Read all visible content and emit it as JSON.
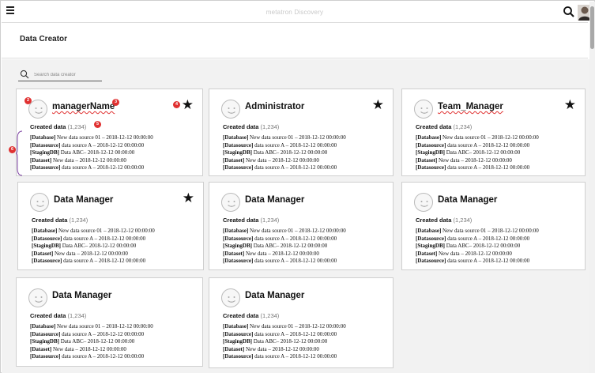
{
  "app": {
    "title": "metatron Discovery"
  },
  "page": {
    "title": "Data Creator"
  },
  "search": {
    "placeholder": "Search data creator"
  },
  "cards": [
    {
      "name": "managerName",
      "starred": true,
      "squiggle": true,
      "created_label": "Created data",
      "created_count": "(1,234)",
      "entries": [
        {
          "type": "[Database]",
          "text": " New data source 01 – 2018-12-12 00:00:00"
        },
        {
          "type": "[Datasource]",
          "text": " data source A – 2018-12-12 00:00:00"
        },
        {
          "type": "[StagingDB]",
          "text": " Data ABC– 2018-12-12 00:00:00"
        },
        {
          "type": "[Dataset]",
          "text": " New data – 2018-12-12 00:00:00"
        },
        {
          "type": "[Datasource]",
          "text": " data source A – 2018-12-12 00:00:00"
        }
      ],
      "markers": [
        "2",
        "3",
        "4",
        "5",
        "6"
      ]
    },
    {
      "name": "Administrator",
      "starred": true,
      "squiggle": false,
      "created_label": "Created data",
      "created_count": "(1,234)",
      "entries": [
        {
          "type": "[Database]",
          "text": " New data source 01 – 2018-12-12 00:00:00"
        },
        {
          "type": "[Datasource]",
          "text": " data source A – 2018-12-12 00:00:00"
        },
        {
          "type": "[StagingDB]",
          "text": " Data ABC– 2018-12-12 00:00:00"
        },
        {
          "type": "[Dataset]",
          "text": " New data – 2018-12-12 00:00:00"
        },
        {
          "type": "[Datasource]",
          "text": " data source A – 2018-12-12 00:00:00"
        }
      ]
    },
    {
      "name": "Team_Manager",
      "starred": true,
      "squiggle": true,
      "created_label": "Created data",
      "created_count": "(1,234)",
      "entries": [
        {
          "type": "[Database]",
          "text": " New data source 01 – 2018-12-12 00:00:00"
        },
        {
          "type": "[Datasource]",
          "text": " data source A – 2018-12-12 00:00:00"
        },
        {
          "type": "[StagingDB]",
          "text": " Data ABC– 2018-12-12 00:00:00"
        },
        {
          "type": "[Dataset]",
          "text": " New data – 2018-12-12 00:00:00"
        },
        {
          "type": "[Datasource]",
          "text": " data source A – 2018-12-12 00:00:00"
        }
      ]
    },
    {
      "name": "Data Manager",
      "starred": true,
      "squiggle": false,
      "created_label": "Created data",
      "created_count": "(1,234)",
      "entries": [
        {
          "type": "[Database]",
          "text": " New data source 01 – 2018-12-12 00:00:00"
        },
        {
          "type": "[Datasource]",
          "text": " data source A – 2018-12-12 00:00:00"
        },
        {
          "type": "[StagingDB]",
          "text": " Data ABC– 2018-12-12 00:00:00"
        },
        {
          "type": "[Dataset]",
          "text": " New data – 2018-12-12 00:00:00"
        },
        {
          "type": "[Datasource]",
          "text": " data source A – 2018-12-12 00:00:00"
        }
      ]
    },
    {
      "name": "Data Manager",
      "starred": false,
      "squiggle": false,
      "created_label": "Created data",
      "created_count": "(1,234)",
      "entries": [
        {
          "type": "[Database]",
          "text": " New data source 01 – 2018-12-12 00:00:00"
        },
        {
          "type": "[Datasource]",
          "text": " data source A – 2018-12-12 00:00:00"
        },
        {
          "type": "[StagingDB]",
          "text": " Data ABC– 2018-12-12 00:00:00"
        },
        {
          "type": "[Dataset]",
          "text": " New data – 2018-12-12 00:00:00"
        },
        {
          "type": "[Datasource]",
          "text": " data source A – 2018-12-12 00:00:00"
        }
      ]
    },
    {
      "name": "Data Manager",
      "starred": false,
      "squiggle": false,
      "created_label": "Created data",
      "created_count": "(1,234)",
      "entries": [
        {
          "type": "[Database]",
          "text": " New data source 01 – 2018-12-12 00:00:00"
        },
        {
          "type": "[Datasource]",
          "text": " data source A – 2018-12-12 00:00:00"
        },
        {
          "type": "[StagingDB]",
          "text": " Data ABC– 2018-12-12 00:00:00"
        },
        {
          "type": "[Dataset]",
          "text": " New data – 2018-12-12 00:00:00"
        },
        {
          "type": "[Datasource]",
          "text": " data source A – 2018-12-12 00:00:00"
        }
      ]
    },
    {
      "name": "Data Manager",
      "starred": false,
      "squiggle": false,
      "created_label": "Created data",
      "created_count": "(1,234)",
      "entries": [
        {
          "type": "[Database]",
          "text": " New data source 01 – 2018-12-12 00:00:00"
        },
        {
          "type": "[Datasource]",
          "text": " data source A – 2018-12-12 00:00:00"
        },
        {
          "type": "[StagingDB]",
          "text": " Data ABC– 2018-12-12 00:00:00"
        },
        {
          "type": "[Dataset]",
          "text": " New data – 2018-12-12 00:00:00"
        },
        {
          "type": "[Datasource]",
          "text": " data source A – 2018-12-12 00:00:00"
        }
      ]
    },
    {
      "name": "Data Manager",
      "starred": false,
      "squiggle": false,
      "created_label": "Created data",
      "created_count": "(1,234)",
      "entries": [
        {
          "type": "[Database]",
          "text": " New data source 01 – 2018-12-12 00:00:00"
        },
        {
          "type": "[Datasource]",
          "text": " data source A – 2018-12-12 00:00:00"
        },
        {
          "type": "[StagingDB]",
          "text": " Data ABC– 2018-12-12 00:00:00"
        },
        {
          "type": "[Dataset]",
          "text": " New data – 2018-12-12 00:00:00"
        },
        {
          "type": "[Datasource]",
          "text": " data source A – 2018-12-12 00:00:00"
        }
      ]
    }
  ],
  "icons": {
    "menu": "hamburger-menu-icon",
    "search": "magnifier-icon",
    "avatar": "smiley-face-icon",
    "favorite": "star-icon",
    "user": "user-photo-icon"
  },
  "colors": {
    "marker": "#e03131",
    "content_bg": "#f2f2f2",
    "card_border": "#cfcfcf"
  }
}
